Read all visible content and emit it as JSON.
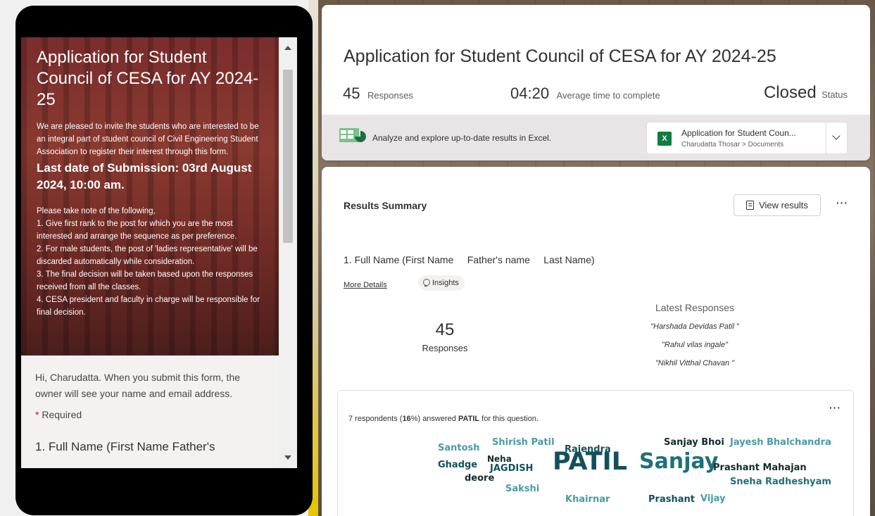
{
  "form_preview": {
    "title": "Application for Student Council of CESA for AY 2024-25",
    "intro": "We are pleased to invite the students who are interested to be an integral part of student council of Civil Engineering Student Association to register their interest through this form.",
    "deadline": "Last date of Submission: 03rd August 2024, 10:00 am.",
    "note_heading": "Please take note of the following,",
    "notes": [
      "1. Give first rank to the post for which you are the most interested and arrange the sequence as per preference.",
      "2. For male students, the post of 'ladies representative' will be discarded automatically while consideration.",
      "3. The final decision will be taken based upon the responses received from all the classes.",
      "4. CESA president and faculty in charge will be responsible for final decision."
    ],
    "greeting": "Hi, Charudatta. When you submit this form, the owner will see your name and email address.",
    "required_star": "*",
    "required_label": "Required",
    "first_question": "1. Full Name (First Name      Father's"
  },
  "header": {
    "title": "Application for Student Council of CESA for AY 2024-25",
    "responses_count": "45",
    "responses_label": "Responses",
    "avg_time": "04:20",
    "avg_time_label": "Average time to complete",
    "status_value": "Closed",
    "status_label": "Status",
    "excel_text": "Analyze and explore up-to-date results in Excel.",
    "file_name": "Application for Student Coun...",
    "file_path": "Charudatta Thosar > Documents"
  },
  "results": {
    "summary_title": "Results Summary",
    "view_results": "View results",
    "more": "···",
    "question": "1. Full Name (First Name     Father's name     Last Name)",
    "more_details": "More Details",
    "insights": "Insights",
    "count": "45",
    "count_label": "Responses",
    "latest_heading": "Latest Responses",
    "latest": [
      "\"Harshada Devidas Patil \"",
      "\"Rahul vilas ingale\"",
      "\"Nikhil Vitthal Chavan \""
    ],
    "insight_summary_pre": "7 respondents (",
    "insight_summary_pct": "16",
    "insight_summary_mid": "%) answered ",
    "insight_summary_word": "PATIL",
    "insight_summary_post": " for this question.",
    "word_cloud": [
      {
        "text": "Santosh",
        "color": "#4a9aa5"
      },
      {
        "text": "Shirish Patil",
        "color": "#4a9aa5"
      },
      {
        "text": "Rajendra",
        "color": "#13505b"
      },
      {
        "text": "Sanjay Bhoi",
        "color": "#13292e"
      },
      {
        "text": "Jayesh Bhalchandra",
        "color": "#4a9aa5"
      },
      {
        "text": "Neha",
        "color": "#13292e"
      },
      {
        "text": "Ghadge",
        "color": "#13505b"
      },
      {
        "text": "JAGDISH",
        "color": "#13505b"
      },
      {
        "text": "PATIL",
        "color": "#13505b"
      },
      {
        "text": "Sanjay",
        "color": "#1f6f7a"
      },
      {
        "text": "Prashant Mahajan",
        "color": "#13292e"
      },
      {
        "text": "deore",
        "color": "#13292e"
      },
      {
        "text": "Sneha Radheshyam",
        "color": "#1f6f7a"
      },
      {
        "text": "Sakshi",
        "color": "#4a9aa5"
      },
      {
        "text": "Khairnar",
        "color": "#4a9aa5"
      },
      {
        "text": "Prashant",
        "color": "#13505b"
      },
      {
        "text": "Vijay",
        "color": "#4a9aa5"
      }
    ]
  }
}
